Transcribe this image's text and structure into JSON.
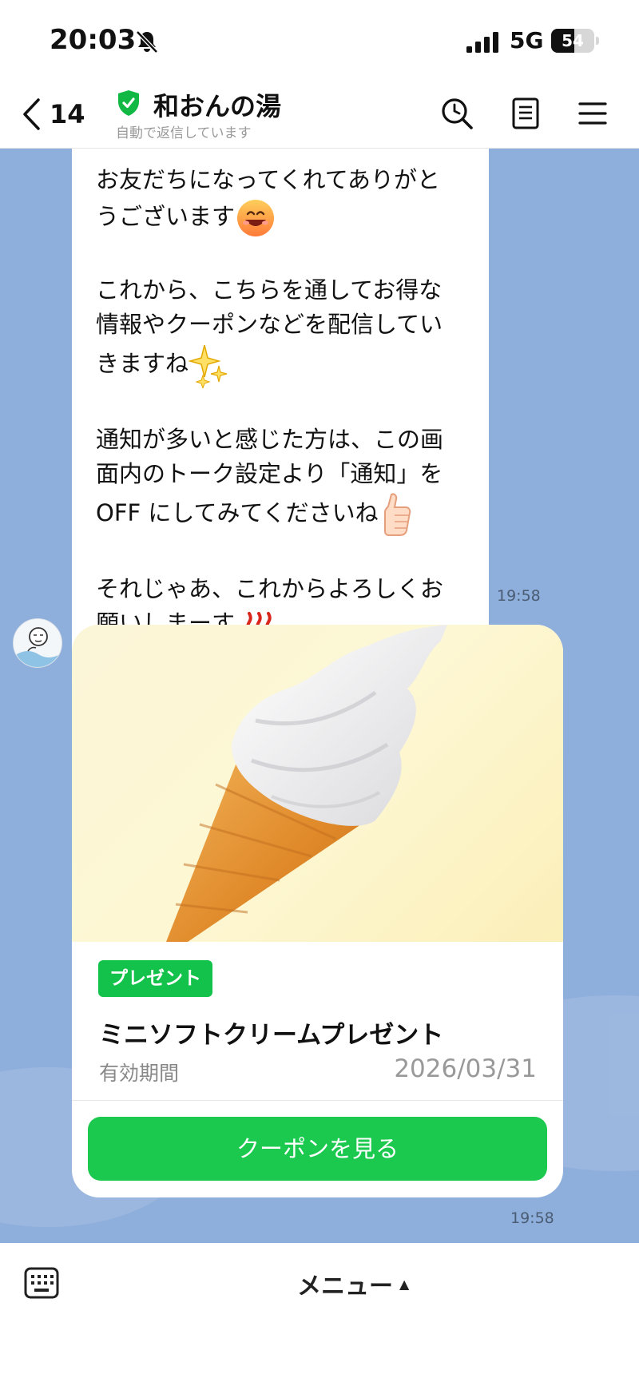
{
  "status_bar": {
    "time": "20:03",
    "network": "5G",
    "battery": "54",
    "battery_level": 0.54
  },
  "header": {
    "back_count": "14",
    "title": "和おんの湯",
    "subtitle": "自動で返信しています"
  },
  "messages": [
    {
      "paragraphs": [
        "お友だちになってくれてありがと\nうございます",
        "これから、こちらを通してお得な\n情報やクーポンなどを配信してい\nきますね",
        "通知が多いと感じた方は、この画\n面内のトーク設定より「通知」を\nOFF にしてみてくださいね",
        "それじゃあ、これからよろしくお\n願いしまーす"
      ],
      "time": "19:58"
    }
  ],
  "coupon": {
    "tag": "プレゼント",
    "title": "ミニソフトクリームプレゼント",
    "valid_label": "有効期間",
    "valid_date": "2026/03/31",
    "button": "クーポンを見る",
    "time": "19:58"
  },
  "bottom_bar": {
    "menu_label": "メニュー",
    "menu_caret": "▲"
  },
  "colors": {
    "chat_background": "#8eaedb",
    "brand_green": "#1bc94f"
  },
  "icons": [
    "bell-off-icon",
    "signal-icon",
    "back-chevron-icon",
    "verified-shield-icon",
    "search-icon",
    "notes-icon",
    "hamburger-menu-icon",
    "keyboard-icon"
  ]
}
